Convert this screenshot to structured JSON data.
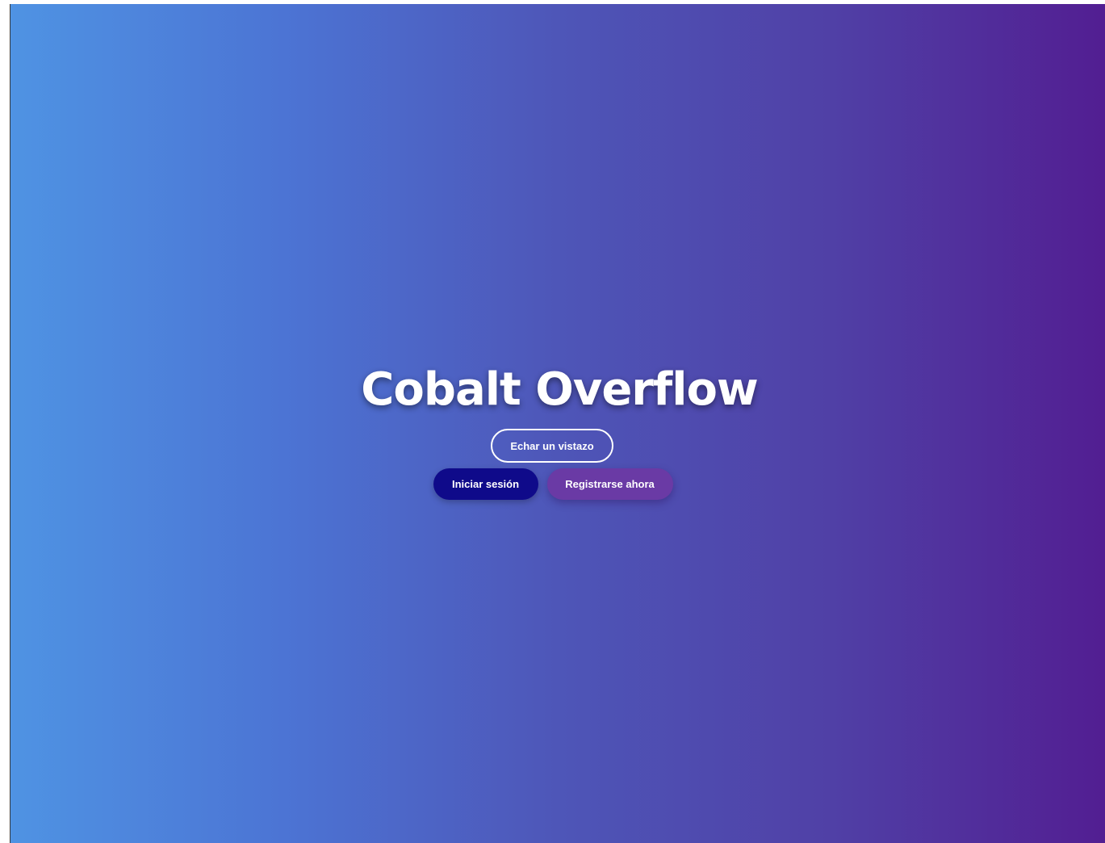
{
  "hero": {
    "title": "Cobalt Overflow",
    "browse_label": "Echar un vistazo",
    "login_label": "Iniciar sesión",
    "register_label": "Registrarse ahora"
  },
  "colors": {
    "gradient_start": "#4f93e3",
    "gradient_end": "#521e92",
    "login_button": "#0f0a8a",
    "register_button": "#6a3aa5"
  }
}
